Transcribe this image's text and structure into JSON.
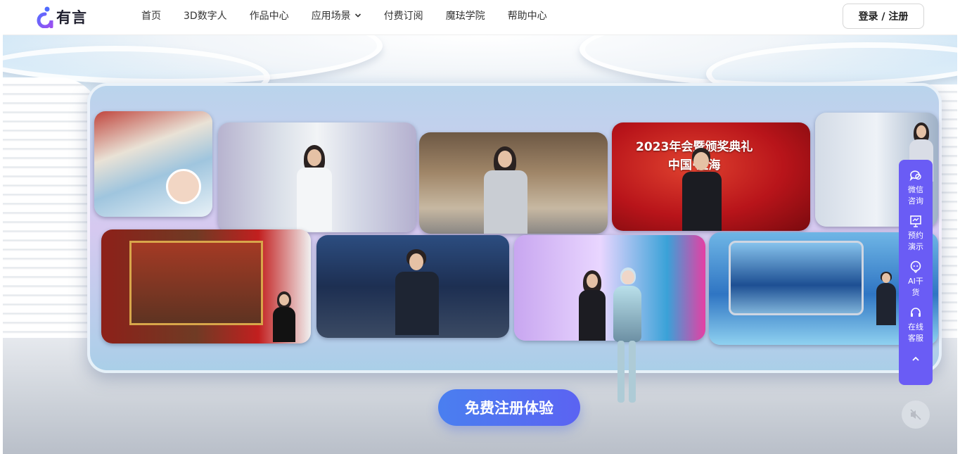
{
  "header": {
    "logo_text": "有言",
    "nav": [
      {
        "label": "首页"
      },
      {
        "label": "3D数字人"
      },
      {
        "label": "作品中心"
      },
      {
        "label": "应用场景",
        "has_dropdown": true
      },
      {
        "label": "付费订阅"
      },
      {
        "label": "魔珐学院"
      },
      {
        "label": "帮助中心"
      }
    ],
    "login_label": "登录 / 注册"
  },
  "hero": {
    "tile_headline": "2023年会暨颁奖典礼\n中国·上海",
    "cta_label": "免费注册体验",
    "mute_icon": "speaker-muted-icon"
  },
  "float_panel": {
    "items": [
      {
        "label": "微信咨询",
        "icon": "chat-bubble-icon"
      },
      {
        "label": "预约演示",
        "icon": "presentation-board-icon"
      },
      {
        "label": "AI干货",
        "icon": "ai-bot-icon"
      },
      {
        "label": "在线客服",
        "icon": "headset-icon"
      }
    ],
    "up_icon": "chevron-up-icon"
  },
  "colors": {
    "brand_purple": "#6a5cf5",
    "cta_blue": "#4a7ff0",
    "nav_text": "#333333"
  }
}
